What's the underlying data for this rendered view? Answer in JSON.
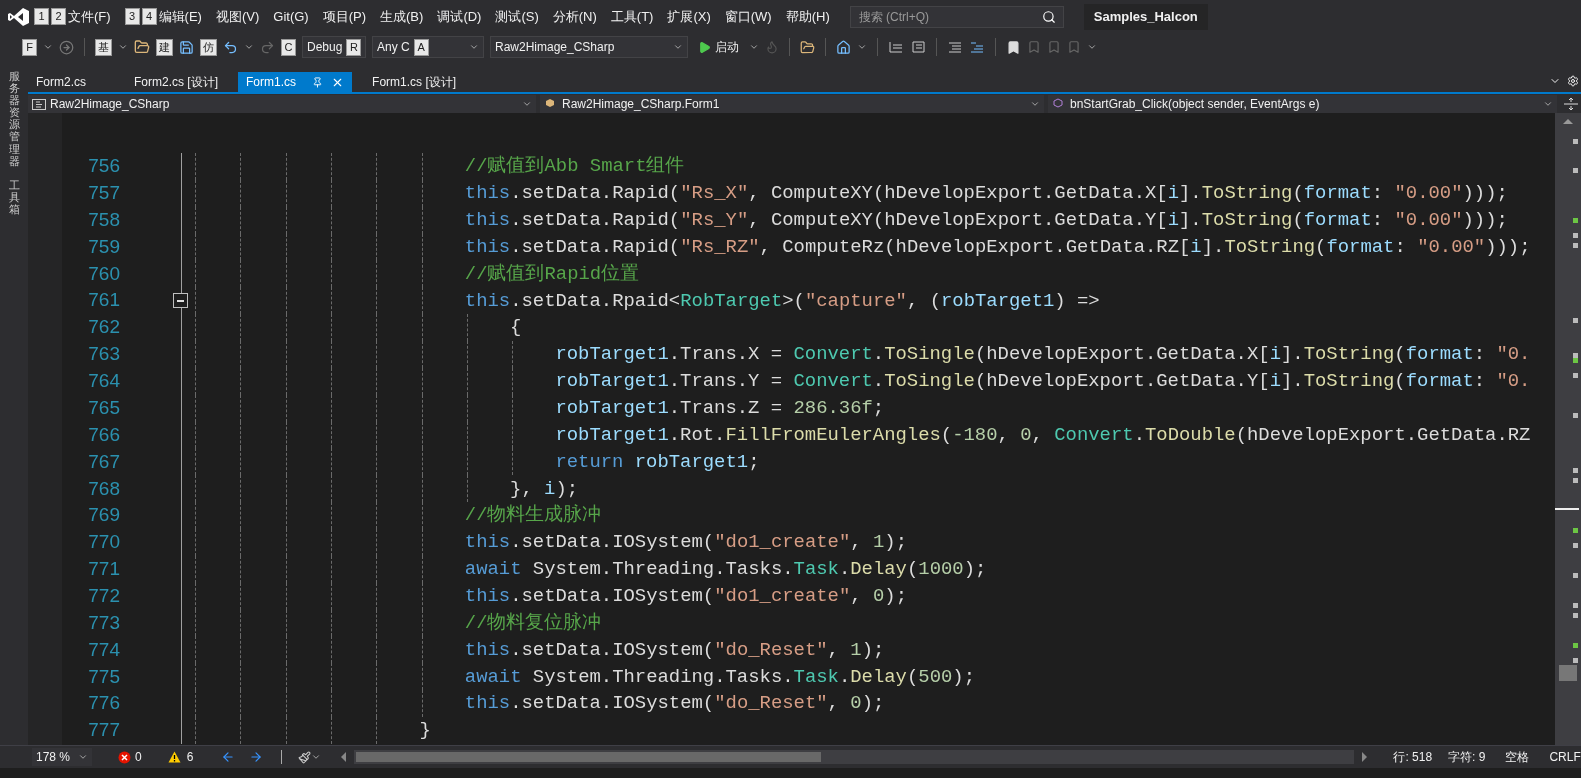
{
  "menu_bar": {
    "items": [
      {
        "label": "文件(F)",
        "keytips": [
          "1",
          "2"
        ]
      },
      {
        "label": "编辑(E)",
        "keytips": [
          "3",
          "4"
        ]
      },
      {
        "label": "视图(V)"
      },
      {
        "label": "Git(G)"
      },
      {
        "label": "项目(P)"
      },
      {
        "label": "生成(B)"
      },
      {
        "label": "调试(D)"
      },
      {
        "label": "测试(S)"
      },
      {
        "label": "分析(N)"
      },
      {
        "label": "工具(T)"
      },
      {
        "label": "扩展(X)"
      },
      {
        "label": "窗口(W)"
      },
      {
        "label": "帮助(H)"
      }
    ],
    "search": {
      "placeholder": "搜索 (Ctrl+Q)"
    },
    "solution_title": "Samples_Halcon"
  },
  "toolbar": {
    "keytips": [
      "F",
      "基",
      "建",
      "仿",
      "C"
    ],
    "configuration": {
      "value": "Debug",
      "keytip": "R"
    },
    "platform": {
      "value": "Any C",
      "keytip": "A"
    },
    "startup_project": "Raw2Himage_CSharp",
    "start_label": "启动"
  },
  "side_tabs": [
    "服务器资源管理器",
    "工具箱"
  ],
  "tabs": [
    {
      "label": "Form2.cs",
      "selected": false
    },
    {
      "label": "Form2.cs [设计]",
      "selected": false
    },
    {
      "label": "Form1.cs",
      "selected": true
    },
    {
      "label": "Form1.cs [设计]",
      "selected": false
    }
  ],
  "navigation_bar": {
    "project": "Raw2Himage_CSharp",
    "class": "Raw2Himage_CSharp.Form1",
    "member": "bnStartGrab_Click(object sender, EventArgs e)"
  },
  "code": {
    "lines": [
      {
        "number": "756",
        "tokens": [
          {
            "kind": "comment",
            "text": "//赋值到Abb Smart组件"
          }
        ]
      },
      {
        "number": "757",
        "tokens": [
          {
            "kind": "keyword",
            "text": "this"
          },
          {
            "kind": "plain",
            "text": ".setData.Rapid("
          },
          {
            "kind": "string",
            "text": "\"Rs_X\""
          },
          {
            "kind": "plain",
            "text": ", ComputeXY(hDevelopExport.GetData.X["
          },
          {
            "kind": "variable",
            "text": "i"
          },
          {
            "kind": "plain",
            "text": "]."
          },
          {
            "kind": "method",
            "text": "ToString"
          },
          {
            "kind": "plain",
            "text": "("
          },
          {
            "kind": "variable",
            "text": "format"
          },
          {
            "kind": "plain",
            "text": ": "
          },
          {
            "kind": "string",
            "text": "\"0.00\""
          },
          {
            "kind": "plain",
            "text": ")));"
          }
        ]
      },
      {
        "number": "758",
        "tokens": [
          {
            "kind": "keyword",
            "text": "this"
          },
          {
            "kind": "plain",
            "text": ".setData.Rapid("
          },
          {
            "kind": "string",
            "text": "\"Rs_Y\""
          },
          {
            "kind": "plain",
            "text": ", ComputeXY(hDevelopExport.GetData.Y["
          },
          {
            "kind": "variable",
            "text": "i"
          },
          {
            "kind": "plain",
            "text": "]."
          },
          {
            "kind": "method",
            "text": "ToString"
          },
          {
            "kind": "plain",
            "text": "("
          },
          {
            "kind": "variable",
            "text": "format"
          },
          {
            "kind": "plain",
            "text": ": "
          },
          {
            "kind": "string",
            "text": "\"0.00\""
          },
          {
            "kind": "plain",
            "text": ")));"
          }
        ]
      },
      {
        "number": "759",
        "tokens": [
          {
            "kind": "keyword",
            "text": "this"
          },
          {
            "kind": "plain",
            "text": ".setData.Rapid("
          },
          {
            "kind": "string",
            "text": "\"Rs_RZ\""
          },
          {
            "kind": "plain",
            "text": ", ComputeRz(hDevelopExport.GetData.RZ["
          },
          {
            "kind": "variable",
            "text": "i"
          },
          {
            "kind": "plain",
            "text": "]."
          },
          {
            "kind": "method",
            "text": "ToString"
          },
          {
            "kind": "plain",
            "text": "("
          },
          {
            "kind": "variable",
            "text": "format"
          },
          {
            "kind": "plain",
            "text": ": "
          },
          {
            "kind": "string",
            "text": "\"0.00\""
          },
          {
            "kind": "plain",
            "text": ")));"
          }
        ]
      },
      {
        "number": "760",
        "tokens": [
          {
            "kind": "comment",
            "text": "//赋值到Rapid位置"
          }
        ]
      },
      {
        "number": "761",
        "expanded": true,
        "tokens": [
          {
            "kind": "keyword",
            "text": "this"
          },
          {
            "kind": "plain",
            "text": ".setData.Rpaid<"
          },
          {
            "kind": "type",
            "text": "RobTarget"
          },
          {
            "kind": "plain",
            "text": ">("
          },
          {
            "kind": "string",
            "text": "\"capture\""
          },
          {
            "kind": "plain",
            "text": ", ("
          },
          {
            "kind": "variable",
            "text": "robTarget1"
          },
          {
            "kind": "plain",
            "text": ") =>"
          }
        ],
        "children": [
          {
            "number": "762",
            "tokens": [
              {
                "kind": "plain",
                "text": "{"
              }
            ],
            "children": [
              {
                "number": "763",
                "tokens": [
                  {
                    "kind": "variable",
                    "text": "robTarget1"
                  },
                  {
                    "kind": "plain",
                    "text": ".Trans.X = "
                  },
                  {
                    "kind": "type",
                    "text": "Convert"
                  },
                  {
                    "kind": "plain",
                    "text": "."
                  },
                  {
                    "kind": "method",
                    "text": "ToSingle"
                  },
                  {
                    "kind": "plain",
                    "text": "(hDevelopExport.GetData.X["
                  },
                  {
                    "kind": "variable",
                    "text": "i"
                  },
                  {
                    "kind": "plain",
                    "text": "]."
                  },
                  {
                    "kind": "method",
                    "text": "ToString"
                  },
                  {
                    "kind": "plain",
                    "text": "("
                  },
                  {
                    "kind": "variable",
                    "text": "format"
                  },
                  {
                    "kind": "plain",
                    "text": ": "
                  },
                  {
                    "kind": "string",
                    "text": "\"0."
                  }
                ]
              },
              {
                "number": "764",
                "tokens": [
                  {
                    "kind": "variable",
                    "text": "robTarget1"
                  },
                  {
                    "kind": "plain",
                    "text": ".Trans.Y = "
                  },
                  {
                    "kind": "type",
                    "text": "Convert"
                  },
                  {
                    "kind": "plain",
                    "text": "."
                  },
                  {
                    "kind": "method",
                    "text": "ToSingle"
                  },
                  {
                    "kind": "plain",
                    "text": "(hDevelopExport.GetData.Y["
                  },
                  {
                    "kind": "variable",
                    "text": "i"
                  },
                  {
                    "kind": "plain",
                    "text": "]."
                  },
                  {
                    "kind": "method",
                    "text": "ToString"
                  },
                  {
                    "kind": "plain",
                    "text": "("
                  },
                  {
                    "kind": "variable",
                    "text": "format"
                  },
                  {
                    "kind": "plain",
                    "text": ": "
                  },
                  {
                    "kind": "string",
                    "text": "\"0."
                  }
                ]
              },
              {
                "number": "765",
                "tokens": [
                  {
                    "kind": "variable",
                    "text": "robTarget1"
                  },
                  {
                    "kind": "plain",
                    "text": ".Trans.Z = "
                  },
                  {
                    "kind": "number",
                    "text": "286.36f"
                  },
                  {
                    "kind": "plain",
                    "text": ";"
                  }
                ]
              },
              {
                "number": "766",
                "tokens": [
                  {
                    "kind": "variable",
                    "text": "robTarget1"
                  },
                  {
                    "kind": "plain",
                    "text": ".Rot."
                  },
                  {
                    "kind": "method",
                    "text": "FillFromEulerAngles"
                  },
                  {
                    "kind": "plain",
                    "text": "("
                  },
                  {
                    "kind": "number",
                    "text": "-180"
                  },
                  {
                    "kind": "plain",
                    "text": ", "
                  },
                  {
                    "kind": "number",
                    "text": "0"
                  },
                  {
                    "kind": "plain",
                    "text": ", "
                  },
                  {
                    "kind": "type",
                    "text": "Convert"
                  },
                  {
                    "kind": "plain",
                    "text": "."
                  },
                  {
                    "kind": "method",
                    "text": "ToDouble"
                  },
                  {
                    "kind": "plain",
                    "text": "(hDevelopExport.GetData.RZ"
                  }
                ]
              },
              {
                "number": "767",
                "tokens": [
                  {
                    "kind": "keyword",
                    "text": "return"
                  },
                  {
                    "kind": "variable",
                    "text": "robTarget1",
                    "space_before": true
                  },
                  {
                    "kind": "plain",
                    "text": ";"
                  }
                ]
              }
            ]
          },
          {
            "number": "768",
            "tokens": [
              {
                "kind": "plain",
                "text": "}, "
              },
              {
                "kind": "variable",
                "text": "i"
              },
              {
                "kind": "plain",
                "text": ");"
              }
            ]
          }
        ]
      },
      {
        "number": "769",
        "tokens": [
          {
            "kind": "comment",
            "text": "//物料生成脉冲"
          }
        ]
      },
      {
        "number": "770",
        "tokens": [
          {
            "kind": "keyword",
            "text": "this"
          },
          {
            "kind": "plain",
            "text": ".setData.IOSystem("
          },
          {
            "kind": "string",
            "text": "\"do1_create\""
          },
          {
            "kind": "plain",
            "text": ", "
          },
          {
            "kind": "number",
            "text": "1"
          },
          {
            "kind": "plain",
            "text": ");"
          }
        ]
      },
      {
        "number": "771",
        "tokens": [
          {
            "kind": "keyword",
            "text": "await"
          },
          {
            "kind": "plain",
            "text": " System.Threading.Tasks."
          },
          {
            "kind": "type",
            "text": "Task"
          },
          {
            "kind": "plain",
            "text": "."
          },
          {
            "kind": "method",
            "text": "Delay"
          },
          {
            "kind": "plain",
            "text": "("
          },
          {
            "kind": "number",
            "text": "1000"
          },
          {
            "kind": "plain",
            "text": ");"
          }
        ]
      },
      {
        "number": "772",
        "tokens": [
          {
            "kind": "keyword",
            "text": "this"
          },
          {
            "kind": "plain",
            "text": ".setData.IOSystem("
          },
          {
            "kind": "string",
            "text": "\"do1_create\""
          },
          {
            "kind": "plain",
            "text": ", "
          },
          {
            "kind": "number",
            "text": "0"
          },
          {
            "kind": "plain",
            "text": ");"
          }
        ]
      },
      {
        "number": "773",
        "tokens": [
          {
            "kind": "comment",
            "text": "//物料复位脉冲"
          }
        ]
      },
      {
        "number": "774",
        "tokens": [
          {
            "kind": "keyword",
            "text": "this"
          },
          {
            "kind": "plain",
            "text": ".setData.IOSystem("
          },
          {
            "kind": "string",
            "text": "\"do_Reset\""
          },
          {
            "kind": "plain",
            "text": ", "
          },
          {
            "kind": "number",
            "text": "1"
          },
          {
            "kind": "plain",
            "text": ");"
          }
        ]
      },
      {
        "number": "775",
        "tokens": [
          {
            "kind": "keyword",
            "text": "await"
          },
          {
            "kind": "plain",
            "text": " System.Threading.Tasks."
          },
          {
            "kind": "type",
            "text": "Task"
          },
          {
            "kind": "plain",
            "text": "."
          },
          {
            "kind": "method",
            "text": "Delay"
          },
          {
            "kind": "plain",
            "text": "("
          },
          {
            "kind": "number",
            "text": "500"
          },
          {
            "kind": "plain",
            "text": ");"
          }
        ]
      },
      {
        "number": "776",
        "tokens": [
          {
            "kind": "keyword",
            "text": "this"
          },
          {
            "kind": "plain",
            "text": ".setData.IOSystem("
          },
          {
            "kind": "string",
            "text": "\"do_Reset\""
          },
          {
            "kind": "plain",
            "text": ", "
          },
          {
            "kind": "number",
            "text": "0"
          },
          {
            "kind": "plain",
            "text": ");"
          }
        ]
      }
    ],
    "block_end": {
      "number": "777",
      "tokens": [
        {
          "kind": "plain",
          "text": "}"
        }
      ]
    }
  },
  "status_bar": {
    "zoom": "178 %",
    "errors": "0",
    "warnings": "6",
    "line": "行: 518",
    "column": "字符: 9",
    "indent": "空格",
    "line_ending": "CRLF"
  }
}
